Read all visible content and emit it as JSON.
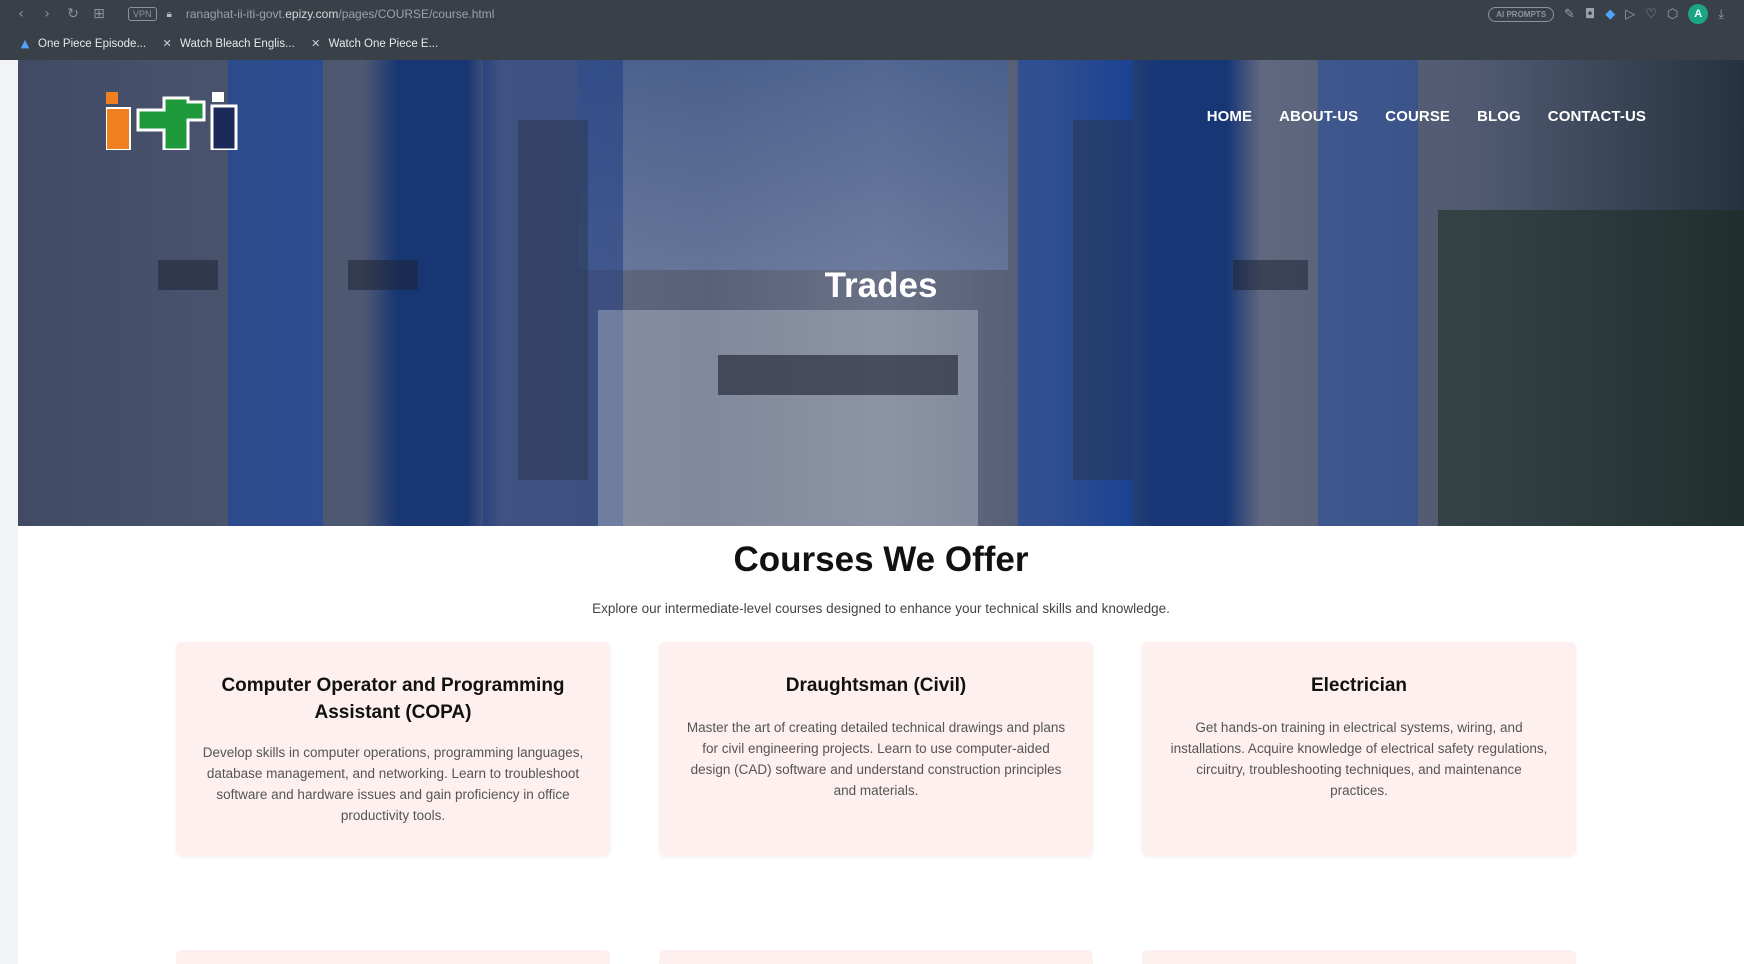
{
  "browser": {
    "vpn_label": "VPN",
    "url_prefix": "ranaghat-ii-iti-govt.",
    "url_domain": "epizy.com",
    "url_path": "/pages/COURSE/course.html",
    "ai_pill": "AI PROMPTS",
    "profile_initial": "A",
    "bookmarks": [
      {
        "label": "One Piece Episode...",
        "icon": "a-icon"
      },
      {
        "label": "Watch Bleach Englis...",
        "icon": "x-icon"
      },
      {
        "label": "Watch One Piece E...",
        "icon": "x-icon"
      }
    ]
  },
  "site": {
    "logo_alt": "iti",
    "logo_colors": {
      "orange": "#f07f1f",
      "green": "#1f9a3a",
      "navy": "#1c2a5a"
    },
    "nav": [
      "HOME",
      "ABOUT-US",
      "COURSE",
      "BLOG",
      "CONTACT-US"
    ],
    "hero_title": "Trades"
  },
  "courses": {
    "title": "Courses We Offer",
    "subtitle": "Explore our intermediate-level courses designed to enhance your technical skills and knowledge.",
    "cards": [
      {
        "title": "Computer Operator and Programming Assistant (COPA)",
        "description": "Develop skills in computer operations, programming languages, database management, and networking. Learn to troubleshoot software and hardware issues and gain proficiency in office productivity tools."
      },
      {
        "title": "Draughtsman (Civil)",
        "description": "Master the art of creating detailed technical drawings and plans for civil engineering projects. Learn to use computer-aided design (CAD) software and understand construction principles and materials."
      },
      {
        "title": "Electrician",
        "description": "Get hands-on training in electrical systems, wiring, and installations. Acquire knowledge of electrical safety regulations, circuitry, troubleshooting techniques, and maintenance practices."
      }
    ]
  }
}
